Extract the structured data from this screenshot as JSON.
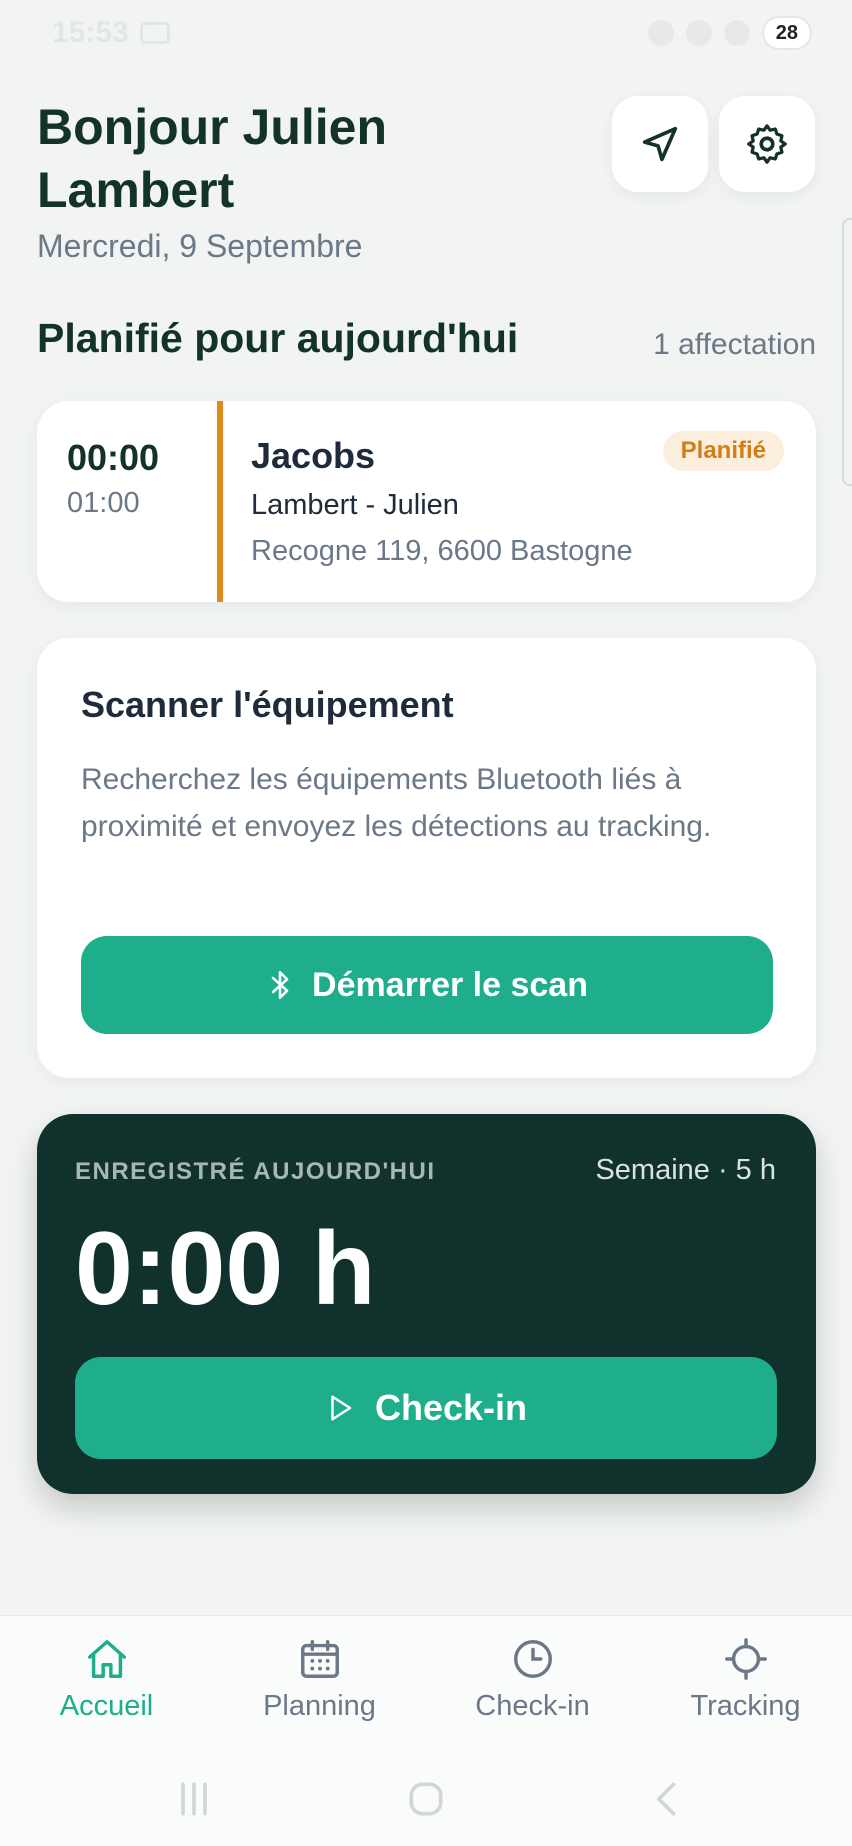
{
  "status_bar": {
    "time": "15:53",
    "battery": "28"
  },
  "header": {
    "greeting": "Bonjour Julien Lambert",
    "date": "Mercredi, 9 Septembre"
  },
  "section": {
    "title": "Planifié pour aujourd'hui",
    "count": "1 affectation"
  },
  "assignment": {
    "start": "00:00",
    "end": "01:00",
    "name": "Jacobs",
    "person": "Lambert - Julien",
    "address": "Recogne 119, 6600 Bastogne",
    "badge": "Planifié",
    "accent": "#e08a1e"
  },
  "scan": {
    "title": "Scanner l'équipement",
    "description": "Recherchez les équipements Bluetooth liés à proximité et envoyez les détections au tracking.",
    "button": "Démarrer le scan",
    "button_icon": "bluetooth-icon"
  },
  "timecard": {
    "label": "ENREGISTRÉ AUJOURD'HUI",
    "week": "Semaine · 5 h",
    "hours": "0:00 h",
    "button": "Check-in",
    "button_icon": "play-icon"
  },
  "nav": {
    "items": [
      {
        "label": "Accueil",
        "icon": "home-icon",
        "active": true
      },
      {
        "label": "Planning",
        "icon": "calendar-icon",
        "active": false
      },
      {
        "label": "Check-in",
        "icon": "clock-icon",
        "active": false
      },
      {
        "label": "Tracking",
        "icon": "crosshair-icon",
        "active": false
      }
    ]
  },
  "colors": {
    "accent": "#1fae8c",
    "dark_card": "#11322c",
    "heading": "#143328",
    "badge": "#d17f18"
  }
}
